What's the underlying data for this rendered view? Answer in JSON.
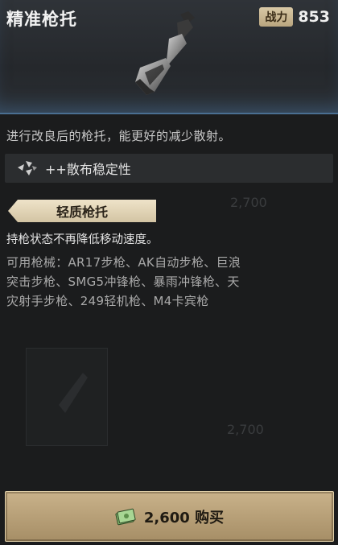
{
  "header": {
    "title": "精准枪托",
    "power_label": "战力",
    "power_value": "853"
  },
  "item": {
    "icon": "stock-icon",
    "description": "进行改良后的枪托，能更好的减少散射。",
    "stat": {
      "icon": "spread-icon",
      "text": "++散布稳定性"
    }
  },
  "background_ghost": {
    "price_1": "2,700",
    "price_2": "2,700"
  },
  "sub_item": {
    "name": "轻质枪托",
    "description": "持枪状态不再降低移动速度。",
    "weapons_line1": "可用枪械：AR17步枪、AK自动步枪、巨浪",
    "weapons_line2": "突击步枪、SMG5冲锋枪、暴雨冲锋枪、天",
    "weapons_line3": "灾射手步枪、249轻机枪、M4卡宾枪"
  },
  "buy_button": {
    "icon": "cash-icon",
    "label": "2,600 购买"
  },
  "colors": {
    "accent_blue": "#4a6f92",
    "button_gold": "#c9b28a"
  }
}
